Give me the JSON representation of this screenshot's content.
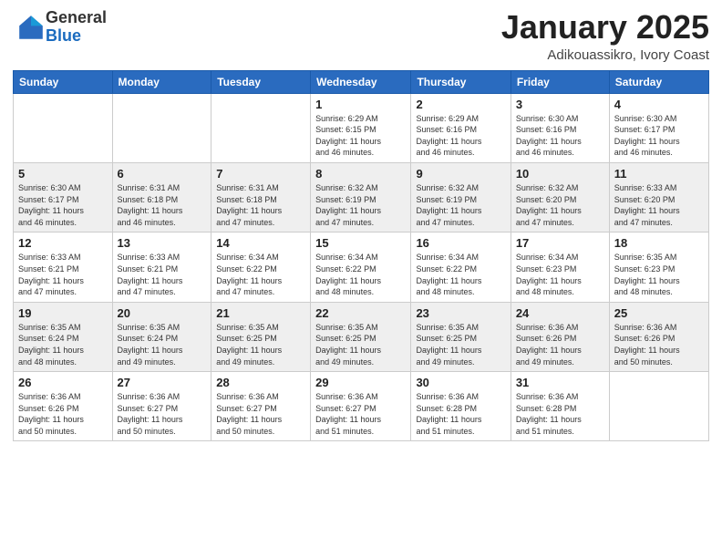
{
  "header": {
    "logo_general": "General",
    "logo_blue": "Blue",
    "month_title": "January 2025",
    "location": "Adikouassikro, Ivory Coast"
  },
  "days_of_week": [
    "Sunday",
    "Monday",
    "Tuesday",
    "Wednesday",
    "Thursday",
    "Friday",
    "Saturday"
  ],
  "weeks": [
    [
      {
        "day": "",
        "info": ""
      },
      {
        "day": "",
        "info": ""
      },
      {
        "day": "",
        "info": ""
      },
      {
        "day": "1",
        "info": "Sunrise: 6:29 AM\nSunset: 6:15 PM\nDaylight: 11 hours\nand 46 minutes."
      },
      {
        "day": "2",
        "info": "Sunrise: 6:29 AM\nSunset: 6:16 PM\nDaylight: 11 hours\nand 46 minutes."
      },
      {
        "day": "3",
        "info": "Sunrise: 6:30 AM\nSunset: 6:16 PM\nDaylight: 11 hours\nand 46 minutes."
      },
      {
        "day": "4",
        "info": "Sunrise: 6:30 AM\nSunset: 6:17 PM\nDaylight: 11 hours\nand 46 minutes."
      }
    ],
    [
      {
        "day": "5",
        "info": "Sunrise: 6:30 AM\nSunset: 6:17 PM\nDaylight: 11 hours\nand 46 minutes."
      },
      {
        "day": "6",
        "info": "Sunrise: 6:31 AM\nSunset: 6:18 PM\nDaylight: 11 hours\nand 46 minutes."
      },
      {
        "day": "7",
        "info": "Sunrise: 6:31 AM\nSunset: 6:18 PM\nDaylight: 11 hours\nand 47 minutes."
      },
      {
        "day": "8",
        "info": "Sunrise: 6:32 AM\nSunset: 6:19 PM\nDaylight: 11 hours\nand 47 minutes."
      },
      {
        "day": "9",
        "info": "Sunrise: 6:32 AM\nSunset: 6:19 PM\nDaylight: 11 hours\nand 47 minutes."
      },
      {
        "day": "10",
        "info": "Sunrise: 6:32 AM\nSunset: 6:20 PM\nDaylight: 11 hours\nand 47 minutes."
      },
      {
        "day": "11",
        "info": "Sunrise: 6:33 AM\nSunset: 6:20 PM\nDaylight: 11 hours\nand 47 minutes."
      }
    ],
    [
      {
        "day": "12",
        "info": "Sunrise: 6:33 AM\nSunset: 6:21 PM\nDaylight: 11 hours\nand 47 minutes."
      },
      {
        "day": "13",
        "info": "Sunrise: 6:33 AM\nSunset: 6:21 PM\nDaylight: 11 hours\nand 47 minutes."
      },
      {
        "day": "14",
        "info": "Sunrise: 6:34 AM\nSunset: 6:22 PM\nDaylight: 11 hours\nand 47 minutes."
      },
      {
        "day": "15",
        "info": "Sunrise: 6:34 AM\nSunset: 6:22 PM\nDaylight: 11 hours\nand 48 minutes."
      },
      {
        "day": "16",
        "info": "Sunrise: 6:34 AM\nSunset: 6:22 PM\nDaylight: 11 hours\nand 48 minutes."
      },
      {
        "day": "17",
        "info": "Sunrise: 6:34 AM\nSunset: 6:23 PM\nDaylight: 11 hours\nand 48 minutes."
      },
      {
        "day": "18",
        "info": "Sunrise: 6:35 AM\nSunset: 6:23 PM\nDaylight: 11 hours\nand 48 minutes."
      }
    ],
    [
      {
        "day": "19",
        "info": "Sunrise: 6:35 AM\nSunset: 6:24 PM\nDaylight: 11 hours\nand 48 minutes."
      },
      {
        "day": "20",
        "info": "Sunrise: 6:35 AM\nSunset: 6:24 PM\nDaylight: 11 hours\nand 49 minutes."
      },
      {
        "day": "21",
        "info": "Sunrise: 6:35 AM\nSunset: 6:25 PM\nDaylight: 11 hours\nand 49 minutes."
      },
      {
        "day": "22",
        "info": "Sunrise: 6:35 AM\nSunset: 6:25 PM\nDaylight: 11 hours\nand 49 minutes."
      },
      {
        "day": "23",
        "info": "Sunrise: 6:35 AM\nSunset: 6:25 PM\nDaylight: 11 hours\nand 49 minutes."
      },
      {
        "day": "24",
        "info": "Sunrise: 6:36 AM\nSunset: 6:26 PM\nDaylight: 11 hours\nand 49 minutes."
      },
      {
        "day": "25",
        "info": "Sunrise: 6:36 AM\nSunset: 6:26 PM\nDaylight: 11 hours\nand 50 minutes."
      }
    ],
    [
      {
        "day": "26",
        "info": "Sunrise: 6:36 AM\nSunset: 6:26 PM\nDaylight: 11 hours\nand 50 minutes."
      },
      {
        "day": "27",
        "info": "Sunrise: 6:36 AM\nSunset: 6:27 PM\nDaylight: 11 hours\nand 50 minutes."
      },
      {
        "day": "28",
        "info": "Sunrise: 6:36 AM\nSunset: 6:27 PM\nDaylight: 11 hours\nand 50 minutes."
      },
      {
        "day": "29",
        "info": "Sunrise: 6:36 AM\nSunset: 6:27 PM\nDaylight: 11 hours\nand 51 minutes."
      },
      {
        "day": "30",
        "info": "Sunrise: 6:36 AM\nSunset: 6:28 PM\nDaylight: 11 hours\nand 51 minutes."
      },
      {
        "day": "31",
        "info": "Sunrise: 6:36 AM\nSunset: 6:28 PM\nDaylight: 11 hours\nand 51 minutes."
      },
      {
        "day": "",
        "info": ""
      }
    ]
  ]
}
